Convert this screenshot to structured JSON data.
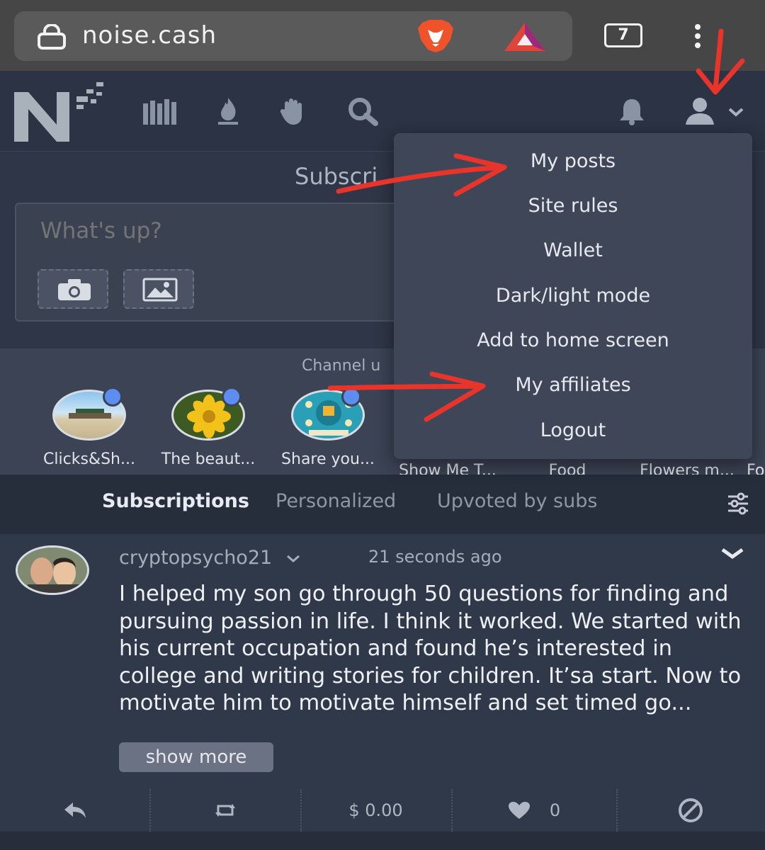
{
  "browser": {
    "url": "noise.cash",
    "tab_count": "7",
    "icons": [
      "lock-icon",
      "brave-lion-icon",
      "bat-triangle-icon",
      "more-vertical-icon"
    ]
  },
  "nav": {
    "icons": [
      "library-icon",
      "flame-icon",
      "hand-icon",
      "search-icon",
      "bell-icon",
      "user-icon",
      "chevron-down-icon"
    ]
  },
  "subscribe": {
    "title": "Subscri",
    "composer_placeholder": "What's up?"
  },
  "channels": {
    "title": "Channel u",
    "items": [
      {
        "label": "Clicks&Sh..."
      },
      {
        "label": "The beaut..."
      },
      {
        "label": "Share you..."
      },
      {
        "label": "Show Me T..."
      },
      {
        "label": "Food"
      },
      {
        "label": "Flowers m..."
      },
      {
        "label": "Fo"
      }
    ]
  },
  "feed_tabs": {
    "subscriptions": "Subscriptions",
    "personalized": "Personalized",
    "upvoted": "Upvoted by subs"
  },
  "post": {
    "username": "cryptopsycho21",
    "time": "21 seconds ago",
    "body": "I helped my son go through 50 questions for finding and pursuing passion in life. I think it worked. We started with his current occupation and found he’s interested in college and writing stories for children. It’sa start. Now to motivate him to motivate himself and set timed go...",
    "show_more": "show more",
    "tip_amount": "$ 0.00",
    "likes": "0"
  },
  "dropdown": {
    "items": [
      {
        "label": "My posts"
      },
      {
        "label": "Site rules"
      },
      {
        "label": "Wallet"
      },
      {
        "label": "Dark/light mode"
      },
      {
        "label": "Add to home screen"
      },
      {
        "label": "My affiliates"
      },
      {
        "label": "Logout"
      }
    ]
  },
  "colors": {
    "annotation_red": "#e8342a",
    "background": "#2e3647",
    "menu_bg": "#3e4657",
    "channel_dot": "#5b8ef0"
  }
}
